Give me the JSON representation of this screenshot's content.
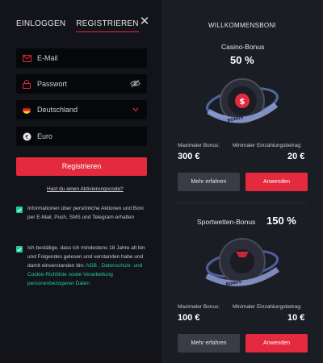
{
  "auth": {
    "tabs": [
      {
        "label": "EINLOGGEN"
      },
      {
        "label": "REGISTRIEREN"
      }
    ],
    "close_icon": "close-icon",
    "email_placeholder": "E-Mail",
    "password_placeholder": "Passwort",
    "country": "Deutschland",
    "currency": "Euro",
    "register_label": "Registrieren",
    "activation_link": "Hast du einen Aktivierungscode?",
    "consent1": "Informationen über persönliche Aktionen und Boni per E-Mail, Push, SMS und Telegram erhalten",
    "consent2_text": "Ich bestätige, dass ich mindestens 18 Jahre alt bin und Folgendes gelesen und verstanden habe und damit einverstanden bin: ",
    "consent2_links": "AGB , Datenschutz- und Cookie-Richtlinie sowie Verarbeitung personenbezogener Daten",
    "accent": "#e42a3e",
    "check_color": "#1ec9a0"
  },
  "bonuses": {
    "title": "WILLKOMMENSBONI",
    "items": [
      {
        "name": "Casino-Bonus",
        "percent": "50 %",
        "max_label": "Maximaler Bonus:",
        "max_value": "300 €",
        "min_label": "Minimaler Einzahlungsbetrag:",
        "min_value": "20 €",
        "more_label": "Mehr erfahren",
        "apply_label": "Anwenden"
      },
      {
        "name": "Sportwetten-Bonus",
        "percent": "150 %",
        "max_label": "Maximaler Bonus:",
        "max_value": "100 €",
        "min_label": "Minimaler Einzahlungsbetrag:",
        "min_value": "10 €",
        "more_label": "Mehr erfahren",
        "apply_label": "Anwenden"
      }
    ],
    "ribbon_text": "BONUS"
  }
}
